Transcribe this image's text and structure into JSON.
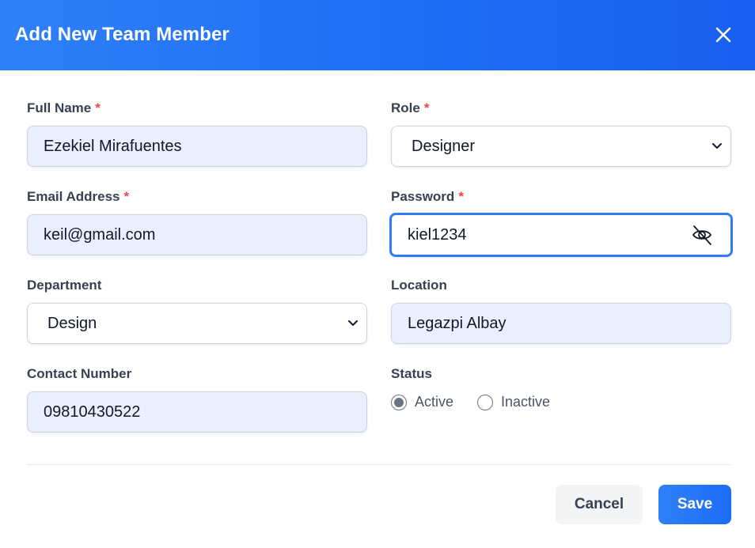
{
  "dialog": {
    "title": "Add New Team Member",
    "close_icon": "close-icon"
  },
  "form": {
    "required_mark": "*",
    "full_name": {
      "label": "Full Name",
      "value": "Ezekiel Mirafuentes"
    },
    "role": {
      "label": "Role",
      "value": "Designer"
    },
    "email": {
      "label": "Email Address",
      "value": "keil@gmail.com"
    },
    "password": {
      "label": "Password",
      "value": "kiel1234",
      "toggle_icon": "eye-off-icon"
    },
    "department": {
      "label": "Department",
      "value": "Design"
    },
    "location": {
      "label": "Location",
      "value": "Legazpi Albay"
    },
    "contact": {
      "label": "Contact Number",
      "value": "09810430522"
    },
    "status": {
      "label": "Status",
      "options": [
        "Active",
        "Inactive"
      ],
      "selected": "Active"
    }
  },
  "footer": {
    "cancel_label": "Cancel",
    "save_label": "Save"
  },
  "colors": {
    "header_blue": "#1e6cf5",
    "required_red": "#ef4444",
    "input_fill": "#e8effd",
    "focus_border": "#2f7cf6"
  }
}
